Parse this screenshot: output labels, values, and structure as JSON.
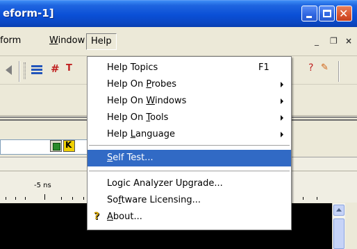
{
  "window": {
    "title": "eform-1]"
  },
  "menubar": {
    "items": [
      "form",
      "Window",
      "Help"
    ],
    "window_underline_prefix": "",
    "mdi": {
      "minimize": "_",
      "restore": "❐",
      "close": "×"
    }
  },
  "help_menu": {
    "items": [
      {
        "pre": "Help Topics",
        "ul": "",
        "post": "",
        "shortcut": "F1",
        "submenu": false
      },
      {
        "pre": "Help On ",
        "ul": "P",
        "post": "robes",
        "shortcut": "",
        "submenu": true
      },
      {
        "pre": "Help On ",
        "ul": "W",
        "post": "indows",
        "shortcut": "",
        "submenu": true
      },
      {
        "pre": "Help On ",
        "ul": "T",
        "post": "ools",
        "shortcut": "",
        "submenu": true
      },
      {
        "pre": "Help ",
        "ul": "L",
        "post": "anguage",
        "shortcut": "",
        "submenu": true
      },
      {
        "pre": "",
        "ul": "S",
        "post": "elf Test...",
        "shortcut": "",
        "submenu": false,
        "selected": true
      },
      {
        "pre": "Logic Analyzer Upgrade...",
        "ul": "",
        "post": "",
        "shortcut": "",
        "submenu": false
      },
      {
        "pre": "So",
        "ul": "f",
        "post": "tware Licensing...",
        "shortcut": "",
        "submenu": false
      },
      {
        "pre": "",
        "ul": "A",
        "post": "bout...",
        "shortcut": "",
        "submenu": false,
        "icon": "help-question-icon"
      }
    ]
  },
  "toolbar": {
    "btn_green": "",
    "btn_yellow": "K"
  },
  "timeline": {
    "label": "-5 ns"
  },
  "colors": {
    "selection": "#316ac5",
    "titlebar": "#0a4fd6",
    "face": "#ece9d8"
  }
}
